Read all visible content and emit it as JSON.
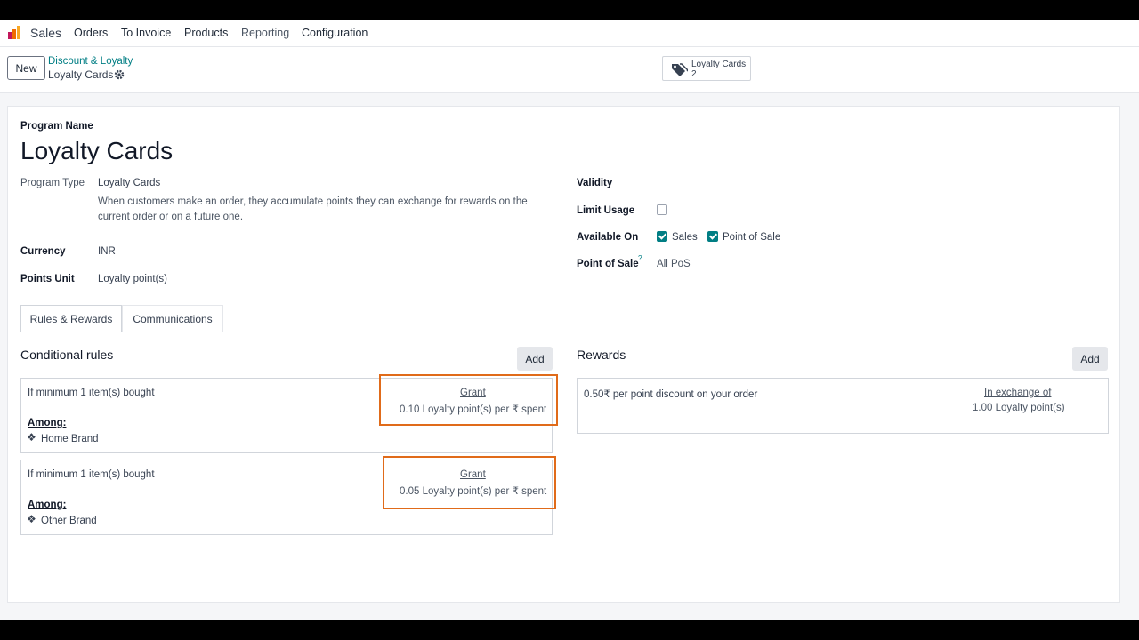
{
  "navbar": {
    "app_name": "Sales",
    "menu": [
      "Orders",
      "To Invoice",
      "Products",
      "Reporting",
      "Configuration"
    ]
  },
  "control": {
    "new_label": "New",
    "breadcrumb_parent": "Discount & Loyalty",
    "breadcrumb_current": "Loyalty Cards",
    "smart_button": {
      "label": "Loyalty Cards",
      "count": "2"
    }
  },
  "form": {
    "program_name_label": "Program Name",
    "program_name": "Loyalty Cards",
    "program_type_label": "Program Type",
    "program_type": "Loyalty Cards",
    "program_type_desc": "When customers make an order, they accumulate points they can exchange for rewards on the current order or on a future one.",
    "currency_label": "Currency",
    "currency": "INR",
    "points_unit_label": "Points Unit",
    "points_unit": "Loyalty point(s)",
    "validity_label": "Validity",
    "limit_usage_label": "Limit Usage",
    "limit_usage": false,
    "available_on_label": "Available On",
    "available_sales": "Sales",
    "available_pos": "Point of Sale",
    "pos_label": "Point of Sale",
    "pos_help": "?",
    "pos_value": "All PoS"
  },
  "tabs": [
    "Rules & Rewards",
    "Communications"
  ],
  "rules": {
    "title": "Conditional rules",
    "add_label": "Add",
    "items": [
      {
        "condition": "If minimum 1 item(s) bought",
        "grant_label": "Grant",
        "grant_value": "0.10 Loyalty point(s) per ₹ spent",
        "among_label": "Among:",
        "among_value": "Home Brand"
      },
      {
        "condition": "If minimum 1 item(s) bought",
        "grant_label": "Grant",
        "grant_value": "0.05 Loyalty point(s) per ₹ spent",
        "among_label": "Among:",
        "among_value": "Other Brand"
      }
    ]
  },
  "rewards": {
    "title": "Rewards",
    "add_label": "Add",
    "items": [
      {
        "description": "0.50₹ per point discount on your order",
        "exchange_label": "In exchange of",
        "exchange_value": "1.00 Loyalty point(s)"
      }
    ]
  },
  "colors": {
    "accent": "#017e84",
    "highlight": "#e06b1a"
  }
}
